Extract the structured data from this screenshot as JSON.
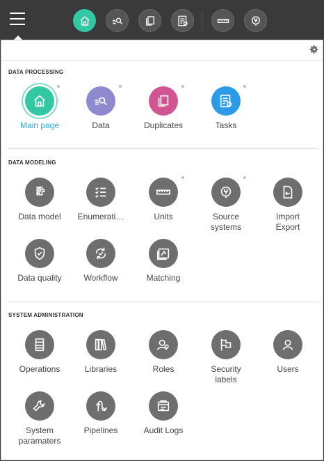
{
  "topbar": {
    "buttons": [
      {
        "icon": "home-icon",
        "active": true
      },
      {
        "icon": "data-search-icon",
        "active": false
      },
      {
        "icon": "duplicates-icon",
        "active": false
      },
      {
        "icon": "tasks-icon",
        "active": false
      },
      {
        "icon": "units-icon",
        "active": false
      },
      {
        "icon": "source-systems-icon",
        "active": false
      }
    ]
  },
  "sections": [
    {
      "title": "DATA PROCESSING",
      "items": [
        {
          "label": "Main page",
          "icon": "home-icon",
          "color": "#33c7a3",
          "selected": true
        },
        {
          "label": "Data",
          "icon": "data-search-icon",
          "color": "#8f8ad0"
        },
        {
          "label": "Duplicates",
          "icon": "duplicates-icon",
          "color": "#d05592"
        },
        {
          "label": "Tasks",
          "icon": "tasks-icon",
          "color": "#2b9be8"
        }
      ]
    },
    {
      "title": "DATA MODELING",
      "items": [
        {
          "label": "Data model",
          "icon": "data-model-icon",
          "color": "#6e6e6e"
        },
        {
          "label": "Enumerati…",
          "icon": "enumerations-icon",
          "color": "#6e6e6e"
        },
        {
          "label": "Units",
          "icon": "units-icon",
          "color": "#6e6e6e"
        },
        {
          "label": "Source\nsystems",
          "icon": "source-systems-icon",
          "color": "#6e6e6e"
        },
        {
          "label": "Import\nExport",
          "icon": "import-export-icon",
          "color": "#6e6e6e"
        },
        {
          "label": "Data quality",
          "icon": "data-quality-icon",
          "color": "#6e6e6e"
        },
        {
          "label": "Workflow",
          "icon": "workflow-icon",
          "color": "#6e6e6e"
        },
        {
          "label": "Matching",
          "icon": "matching-icon",
          "color": "#6e6e6e"
        }
      ]
    },
    {
      "title": "SYSTEM ADMINISTRATION",
      "items": [
        {
          "label": "Operations",
          "icon": "operations-icon",
          "color": "#6e6e6e"
        },
        {
          "label": "Libraries",
          "icon": "libraries-icon",
          "color": "#6e6e6e"
        },
        {
          "label": "Roles",
          "icon": "roles-icon",
          "color": "#6e6e6e"
        },
        {
          "label": "Security\nlabels",
          "icon": "security-labels-icon",
          "color": "#6e6e6e"
        },
        {
          "label": "Users",
          "icon": "user-icon",
          "color": "#6e6e6e"
        },
        {
          "label": "System\nparamaters",
          "icon": "wrench-icon",
          "color": "#6e6e6e"
        },
        {
          "label": "Pipelines",
          "icon": "pipelines-icon",
          "color": "#6e6e6e"
        },
        {
          "label": "Audit Logs",
          "icon": "audit-logs-icon",
          "color": "#6e6e6e"
        }
      ]
    }
  ]
}
